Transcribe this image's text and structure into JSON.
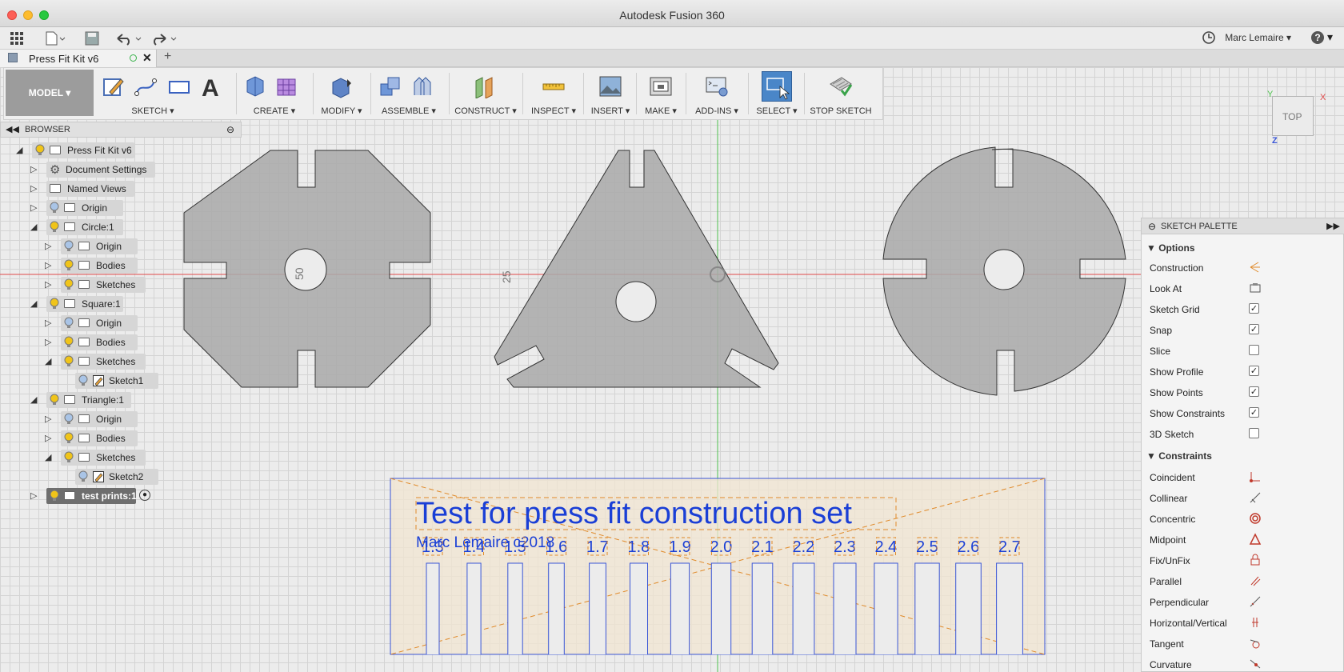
{
  "window": {
    "title": "Autodesk Fusion 360"
  },
  "quickbar": {
    "user": "Marc Lemaire ▾",
    "help": "?"
  },
  "tab": {
    "label": "Press Fit Kit v6",
    "close": "✕",
    "new": "+"
  },
  "toolbar": {
    "workspace": "MODEL ▾",
    "groups": [
      {
        "label": "SKETCH ▾"
      },
      {
        "label": "CREATE ▾"
      },
      {
        "label": "MODIFY ▾"
      },
      {
        "label": "ASSEMBLE ▾"
      },
      {
        "label": "CONSTRUCT ▾"
      },
      {
        "label": "INSPECT ▾"
      },
      {
        "label": "INSERT ▾"
      },
      {
        "label": "MAKE ▾"
      },
      {
        "label": "ADD-INS ▾"
      },
      {
        "label": "SELECT ▾"
      },
      {
        "label": "STOP SKETCH"
      }
    ]
  },
  "browser": {
    "title": "BROWSER",
    "items": [
      {
        "label": "Press Fit Kit v6"
      },
      {
        "label": "Document Settings"
      },
      {
        "label": "Named Views"
      },
      {
        "label": "Origin"
      },
      {
        "label": "Circle:1"
      },
      {
        "label": "Origin"
      },
      {
        "label": "Bodies"
      },
      {
        "label": "Sketches"
      },
      {
        "label": "Square:1"
      },
      {
        "label": "Origin"
      },
      {
        "label": "Bodies"
      },
      {
        "label": "Sketches"
      },
      {
        "label": "Sketch1"
      },
      {
        "label": "Triangle:1"
      },
      {
        "label": "Origin"
      },
      {
        "label": "Bodies"
      },
      {
        "label": "Sketches"
      },
      {
        "label": "Sketch2"
      },
      {
        "label": "test prints:1"
      }
    ]
  },
  "canvas": {
    "dim_square": "50",
    "dim_triangle": "25",
    "sketch_title": "Test for press fit construction set",
    "sketch_author": "Marc Lemaire c2018",
    "slot_labels": [
      "1.3",
      "1.4",
      "1.5",
      "1.6",
      "1.7",
      "1.8",
      "1.9",
      "2.0",
      "2.1",
      "2.2",
      "2.3",
      "2.4",
      "2.5",
      "2.6",
      "2.7"
    ]
  },
  "viewcube": {
    "face": "TOP"
  },
  "palette": {
    "title": "SKETCH PALETTE",
    "options_title": "Options",
    "options": [
      {
        "label": "Construction"
      },
      {
        "label": "Look At"
      },
      {
        "label": "Sketch Grid",
        "checked": true
      },
      {
        "label": "Snap",
        "checked": true
      },
      {
        "label": "Slice",
        "checked": false
      },
      {
        "label": "Show Profile",
        "checked": true
      },
      {
        "label": "Show Points",
        "checked": true
      },
      {
        "label": "Show Constraints",
        "checked": true
      },
      {
        "label": "3D Sketch",
        "checked": false
      }
    ],
    "constraints_title": "Constraints",
    "constraints": [
      {
        "label": "Coincident"
      },
      {
        "label": "Collinear"
      },
      {
        "label": "Concentric"
      },
      {
        "label": "Midpoint"
      },
      {
        "label": "Fix/UnFix"
      },
      {
        "label": "Parallel"
      },
      {
        "label": "Perpendicular"
      },
      {
        "label": "Horizontal/Vertical"
      },
      {
        "label": "Tangent"
      },
      {
        "label": "Curvature"
      }
    ]
  },
  "colors": {
    "accent": "#4a86c8",
    "sketch_blue": "#1a3fd6",
    "construction_orange": "#e08a2a",
    "bulb": "#f0c419"
  }
}
